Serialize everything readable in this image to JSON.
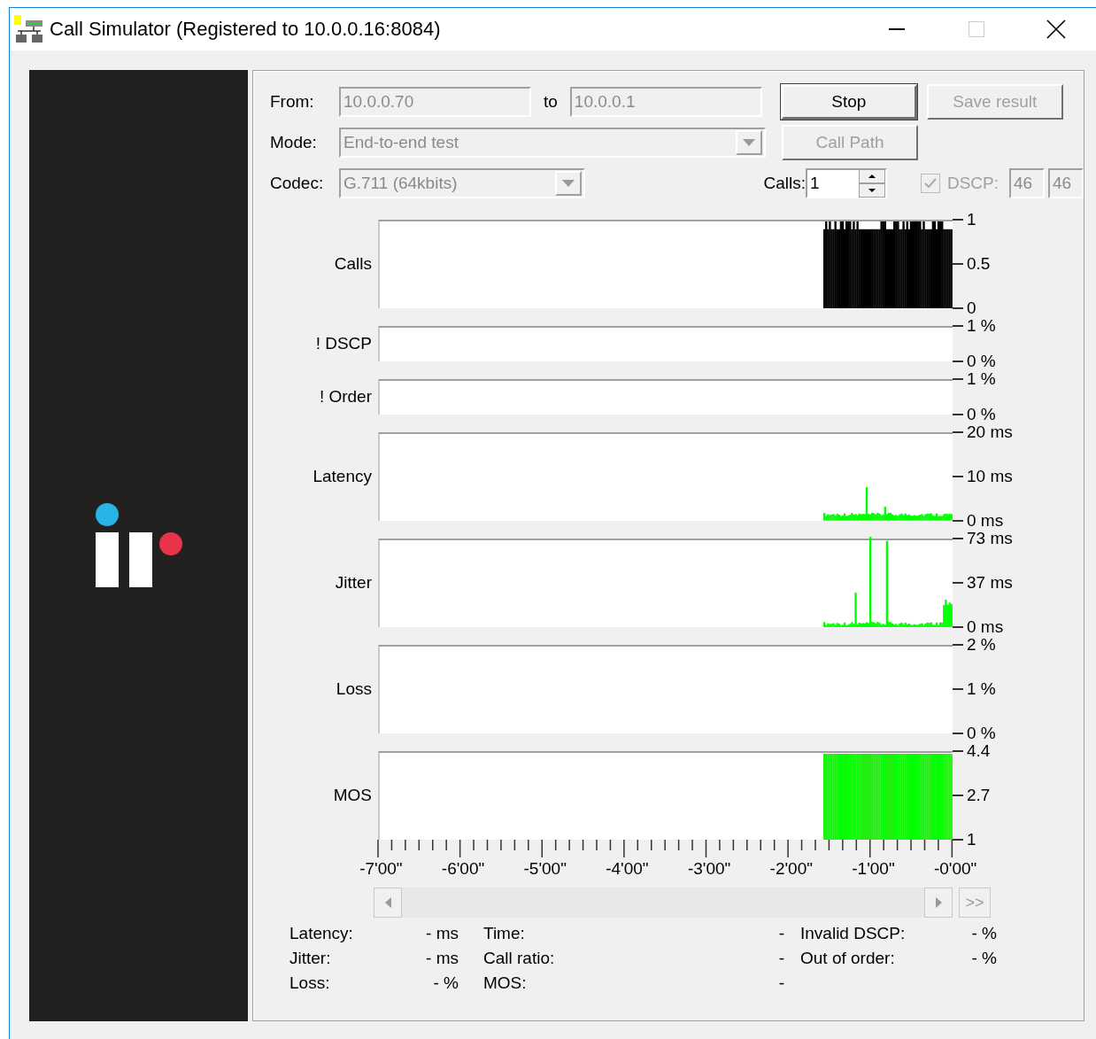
{
  "window": {
    "title": "Call Simulator (Registered to 10.0.0.16:8084)"
  },
  "form": {
    "from": {
      "label": "From:",
      "value": "10.0.0.70",
      "disabled": true
    },
    "to": {
      "label": "to",
      "value": "10.0.0.1",
      "disabled": true
    },
    "mode": {
      "label": "Mode:",
      "value": "End-to-end test",
      "disabled": true
    },
    "codec": {
      "label": "Codec:",
      "value": "G.711 (64kbits)",
      "disabled": true
    },
    "calls": {
      "label": "Calls:",
      "value": "1"
    },
    "dscp": {
      "label": "DSCP:",
      "checked": true,
      "disabled": true,
      "values": [
        "46",
        "46"
      ]
    }
  },
  "buttons": [
    {
      "label": "Stop",
      "disabled": false,
      "default": true
    },
    {
      "label": "Save result",
      "disabled": true,
      "default": false
    },
    {
      "label": "Call Path",
      "disabled": true,
      "default": false
    }
  ],
  "graphs": [
    {
      "label": "Calls",
      "kind": "block",
      "ticks": [
        "1",
        "0.5",
        "0"
      ]
    },
    {
      "label": "! DSCP",
      "kind": "flag",
      "ticks": [
        "1 %",
        "0 %"
      ]
    },
    {
      "label": "! Order",
      "kind": "flag",
      "ticks": [
        "1 %",
        "0 %"
      ]
    },
    {
      "label": "Latency",
      "kind": "low",
      "ticks": [
        "20 ms",
        "10 ms",
        "0 ms"
      ]
    },
    {
      "label": "Jitter",
      "kind": "spikes",
      "ticks": [
        "73 ms",
        "37 ms",
        "0 ms"
      ]
    },
    {
      "label": "Loss",
      "kind": "empty",
      "ticks": [
        "2 %",
        "1 %",
        "0 %"
      ]
    },
    {
      "label": "MOS",
      "kind": "full",
      "ticks": [
        "4.4",
        "2.7",
        "1"
      ]
    }
  ],
  "time_axis": [
    "-7'00\"",
    "-6'00\"",
    "-5'00\"",
    "-4'00\"",
    "-3'00\"",
    "-2'00\"",
    "-1'00\"",
    "-0'00\""
  ],
  "jump_button": ">>",
  "stats": [
    [
      {
        "label": "Latency:",
        "value": "- ms"
      },
      {
        "label": "Jitter:",
        "value": "- ms"
      },
      {
        "label": "Loss:",
        "value": "- %"
      }
    ],
    [
      {
        "label": "Time:",
        "value": "-"
      },
      {
        "label": "Call ratio:",
        "value": "-"
      },
      {
        "label": "MOS:",
        "value": "-"
      }
    ],
    [
      {
        "label": "Invalid DSCP:",
        "value": "- %"
      },
      {
        "label": "Out of order:",
        "value": "- %"
      }
    ]
  ]
}
